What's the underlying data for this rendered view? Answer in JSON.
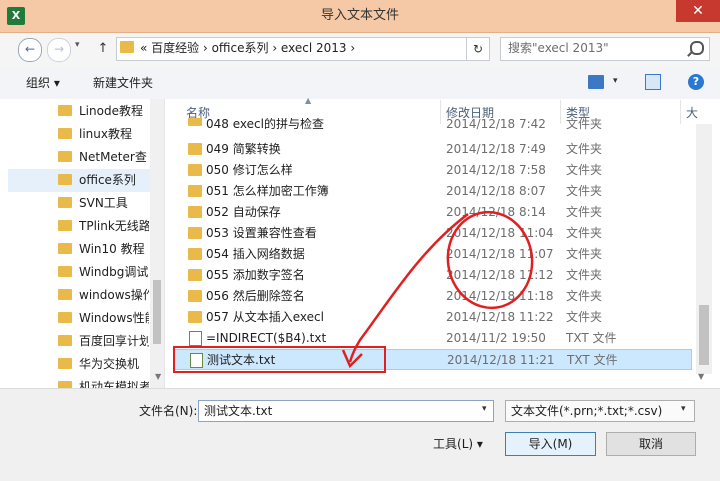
{
  "window": {
    "title": "导入文本文件",
    "app_icon": "X",
    "close_label": "✕"
  },
  "nav": {
    "back_icon": "arrow-left-icon",
    "forward_icon": "arrow-right-icon",
    "up_icon": "arrow-up-icon",
    "address": "«  百度经验  ›  office系列  ›  execl 2013  ›",
    "refresh_icon": "refresh-icon",
    "search_placeholder": "搜索\"execl 2013\""
  },
  "toolbar": {
    "organize": "组织 ▾",
    "new_folder": "新建文件夹"
  },
  "sidebar": {
    "items": [
      {
        "label": "Linode教程"
      },
      {
        "label": "linux教程"
      },
      {
        "label": "NetMeter查"
      },
      {
        "label": "office系列"
      },
      {
        "label": "SVN工具"
      },
      {
        "label": "TPlink无线路"
      },
      {
        "label": "Win10 教程"
      },
      {
        "label": "Windbg调试"
      },
      {
        "label": "windows操作"
      },
      {
        "label": "Windows性能"
      },
      {
        "label": "百度回享计划"
      },
      {
        "label": "华为交换机"
      },
      {
        "label": "机动车模拟考"
      }
    ]
  },
  "columns": {
    "name": "名称",
    "date": "修改日期",
    "type": "类型",
    "size": "大"
  },
  "files": [
    {
      "name": "048 execl的拼与检查",
      "date": "2014/12/18 7:42",
      "type": "文件夹"
    },
    {
      "name": "049 简繁转换",
      "date": "2014/12/18 7:49",
      "type": "文件夹"
    },
    {
      "name": "050 修订怎么样",
      "date": "2014/12/18 7:58",
      "type": "文件夹"
    },
    {
      "name": "051 怎么样加密工作簿",
      "date": "2014/12/18 8:07",
      "type": "文件夹"
    },
    {
      "name": "052 自动保存",
      "date": "2014/12/18 8:14",
      "type": "文件夹"
    },
    {
      "name": "053 设置兼容性查看",
      "date": "2014/12/18 11:04",
      "type": "文件夹"
    },
    {
      "name": "054 插入网络数据",
      "date": "2014/12/18 11:07",
      "type": "文件夹"
    },
    {
      "name": "055 添加数字签名",
      "date": "2014/12/18 11:12",
      "type": "文件夹"
    },
    {
      "name": "056 然后删除签名",
      "date": "2014/12/18 11:18",
      "type": "文件夹"
    },
    {
      "name": "057 从文本插入execl",
      "date": "2014/12/18 11:22",
      "type": "文件夹"
    },
    {
      "name": "=INDIRECT($B4).txt",
      "date": "2014/11/2 19:50",
      "type": "TXT 文件"
    },
    {
      "name": "测试文本.txt",
      "date": "2014/12/18 11:21",
      "type": "TXT 文件"
    }
  ],
  "bottom": {
    "filename_label": "文件名(N):",
    "filename_value": "测试文本.txt",
    "filetype_value": "文本文件(*.prn;*.txt;*.csv)",
    "tools_label": "工具(L)  ▾",
    "import_label": "导入(M)",
    "cancel_label": "取消"
  },
  "colors": {
    "title_bar": "#f6c9a6",
    "close": "#c7392f",
    "selection": "#cce8ff",
    "annotation": "#e02020",
    "folder": "#e9b949"
  }
}
